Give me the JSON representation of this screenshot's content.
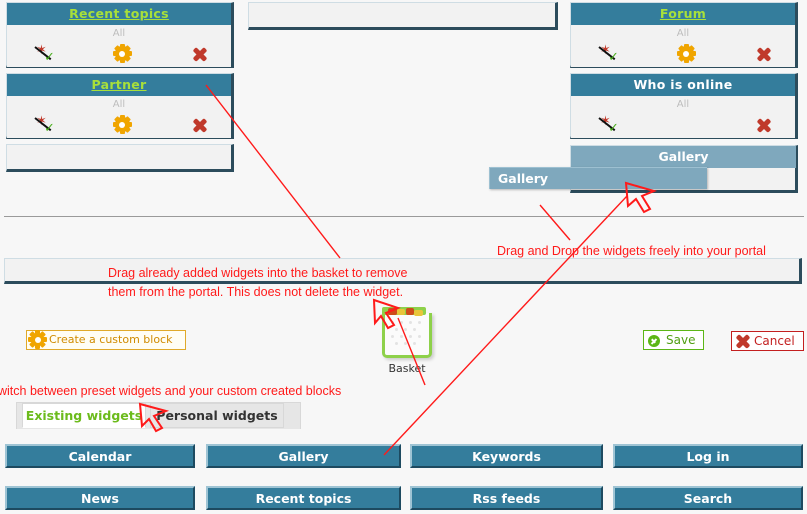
{
  "widgets": [
    {
      "title": "Recent topics",
      "scope": "All",
      "link": true,
      "has_gear": true
    },
    {
      "title": "Partner",
      "scope": "All",
      "link": true,
      "has_gear": true
    },
    {
      "title": "Forum",
      "scope": "All",
      "link": true,
      "has_gear": true
    },
    {
      "title": "Who is online",
      "scope": "All",
      "link": false,
      "has_gear": false
    }
  ],
  "gallery_block": {
    "placeholder_label": "Gallery",
    "drag_ghost_label": "Gallery"
  },
  "annotations": {
    "drag_drop_portal": "Drag and Drop the widgets freely into your portal",
    "basket_line1": "Drag already added widgets into the basket to remove",
    "basket_line2": "them from the portal. This does not delete the widget.",
    "switch_tabs": "witch between preset widgets and your custom created blocks"
  },
  "buttons": {
    "create_custom_block": "Create a custom block",
    "save": "Save",
    "cancel": "Cancel"
  },
  "basket": {
    "label": "Basket"
  },
  "tabs": [
    {
      "label": "Existing widgets",
      "active": true
    },
    {
      "label": "Personal widgets",
      "active": false
    }
  ],
  "palette": {
    "row1": [
      "Calendar",
      "Gallery",
      "Keywords",
      "Log in"
    ],
    "row2": [
      "News",
      "Recent topics",
      "Rss feeds",
      "Search"
    ]
  },
  "icons": {
    "toggle": "toggle-visibility-icon",
    "gear": "gear-icon",
    "remove": "remove-icon",
    "save_check": "check-circle-icon",
    "cancel_x": "x-icon",
    "basket": "basket-icon",
    "cursor": "mouse-cursor-icon"
  },
  "colors": {
    "header_blue": "#347d9c",
    "drag_blue": "#7fa8bd",
    "annotation_red": "#ff1a1a",
    "link_green": "#a8e03a",
    "tab_active_green": "#6cbb1c",
    "save_green": "#5cb616",
    "cancel_red": "#c31f1f",
    "custom_orange": "#d08b00"
  }
}
